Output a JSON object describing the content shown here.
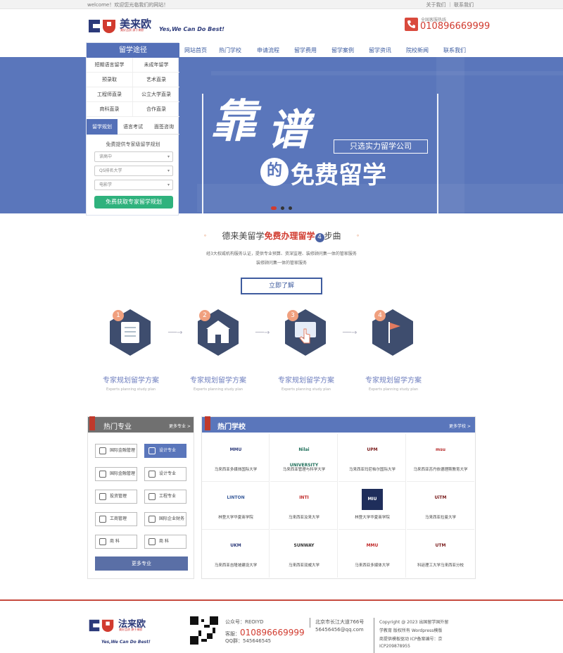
{
  "topbar": {
    "welcome": "welcome！欢迎您光临我们的网站！",
    "links": "关于我们 ｜ 联系我们"
  },
  "header": {
    "brand": "美来欧",
    "brand_sub": "美好品质 源于来欧",
    "slogan": "Yes,We Can Do Best!",
    "hotline_label": "全国客服热线",
    "hotline": "010896669999"
  },
  "nav": [
    "网站首页",
    "热门学校",
    "申请流程",
    "留学费用",
    "留学案例",
    "留学资讯",
    "院校新闻",
    "联系我们"
  ],
  "sidebar": {
    "title": "留学途径",
    "items": [
      "短期语言留学",
      "未成年留学",
      "预录取",
      "艺术直录",
      "工程师直录",
      "公立大学直录",
      "商科直录",
      "合作直录"
    ],
    "tabs": [
      "留学规划",
      "语言考试",
      "面签咨询"
    ],
    "form_title": "免费提供专家级留学规划",
    "selects": [
      "读高中",
      "QS排名大学",
      "电影学"
    ],
    "cta": "免费获取专家留学规划"
  },
  "banner": {
    "big1": "靠",
    "big2": "谱",
    "tag": "只选实力留学公司",
    "de": "的",
    "free": "免费留学"
  },
  "intro": {
    "title_pre": "德来美留学",
    "title_hl": "免费办理留学",
    "step": "4",
    "title_post": "步曲",
    "line1": "经3大权威机构服务认证，提供专业预算、资深监理、装修顾问集一体的管家服务",
    "line2": "装修顾问集一体的管家服务",
    "button": "立即了解"
  },
  "steps": [
    {
      "n": "1",
      "title": "专家规划留学方案",
      "sub": "Experts planning study plan"
    },
    {
      "n": "2",
      "title": "专家规划留学方案",
      "sub": "Experts planning study plan"
    },
    {
      "n": "3",
      "title": "专家规划留学方案",
      "sub": "Experts planning study plan"
    },
    {
      "n": "4",
      "title": "专家规划留学方案",
      "sub": "Experts planning study plan"
    }
  ],
  "majors": {
    "title": "热门专业",
    "more": "更多专业 >",
    "items": [
      "国际金融管理",
      "设计专业",
      "国际金融管理",
      "设计专业",
      "投资管理",
      "工程专业",
      "工商管理",
      "国际企业财务",
      "商 科",
      "商 科"
    ],
    "button": "更多专业"
  },
  "schools": {
    "title": "热门学校",
    "more": "更多学校 >",
    "items": [
      {
        "logo": "MMU",
        "name": "马来西亚多媒体国际大学"
      },
      {
        "logo": "Nilai UNIVERSITY",
        "name": "马来西亚管理与科学大学"
      },
      {
        "logo": "UPM",
        "name": "马来西亚玛尼帕尔国际大学"
      },
      {
        "logo": "msu",
        "name": "马来西亚苏丹依德理斯教育大学"
      },
      {
        "logo": "LINTON",
        "name": "林登大学华夏商学院"
      },
      {
        "logo": "INTI",
        "name": "马来西亚汝来大学"
      },
      {
        "logo": "MIU",
        "name": "林登大学华夏商学院"
      },
      {
        "logo": "UiTM",
        "name": "马来西亚拉曼大学"
      },
      {
        "logo": "UKM",
        "name": "马来西亚吉隆坡建设大学"
      },
      {
        "logo": "SUNWAY",
        "name": "马来西亚双威大学"
      },
      {
        "logo": "MMU",
        "name": "马来西亚多媒体大学"
      },
      {
        "logo": "UTM",
        "name": "科廷理工大学马来西亚分校"
      }
    ]
  },
  "footer": {
    "brand": "法来欧",
    "brand_sub": "美好品质 源于来欧",
    "slogan": "Yes,We Can Do Best!",
    "wechat": "公众号：REOIYD",
    "tel_label": "客服：",
    "tel": "010896669999",
    "qq": "QQ群：545646545",
    "addr": "北京市长江大道766号",
    "email": "56456456@qq.com",
    "copy1": "Copyright @ 2023 出国留学国外留",
    "copy2": "学教育 版权所有   Wordpress模版",
    "copy3": "商提供模板驱动   ICP备案编号：京",
    "copy4": "ICP209878955"
  }
}
